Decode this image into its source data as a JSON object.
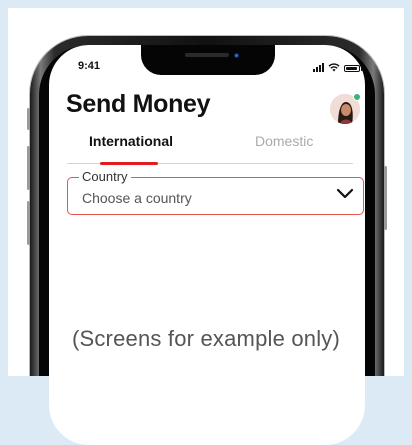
{
  "status_bar": {
    "time": "9:41",
    "icons": [
      "signal-icon",
      "wifi-icon",
      "battery-icon"
    ]
  },
  "header": {
    "title": "Send Money",
    "avatar_status": "online"
  },
  "tabs": [
    {
      "label": "International",
      "active": true
    },
    {
      "label": "Domestic",
      "active": false
    }
  ],
  "country_field": {
    "label": "Country",
    "placeholder": "Choose a country",
    "icon": "chevron-down-icon"
  },
  "caption": "(Screens for example only)",
  "colors": {
    "accent": "#e31b23",
    "field_border": "#e8544e",
    "online_dot": "#3cb371",
    "background": "#dbeaf5"
  }
}
